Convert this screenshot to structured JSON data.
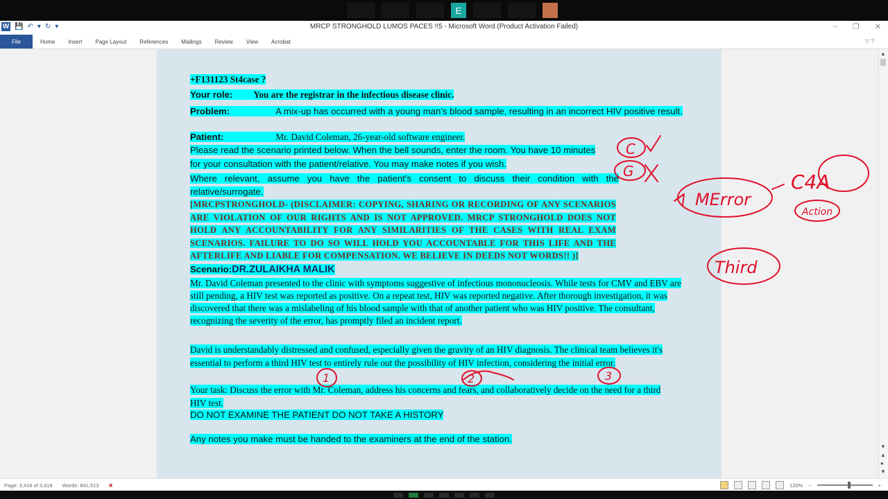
{
  "window": {
    "title": "MRCP STRONGHOLD LUMOS PACES !!5  -  Microsoft Word (Product Activation Failed)"
  },
  "meeting": {
    "self_tile": "E"
  },
  "ribbon": {
    "file": "File",
    "tabs": [
      "Home",
      "Insert",
      "Page Layout",
      "References",
      "Mailings",
      "Review",
      "View",
      "Acrobat"
    ]
  },
  "document": {
    "case_id": "+F131123 St4case ?",
    "role_label": "Your role:",
    "role_text": "You are the registrar in the infectious disease clinic.",
    "problem_label": "Problem:",
    "problem_text": "A mix-up has occurred with a young man's blood sample, resulting in an incorrect HIV positive result.",
    "patient_label": "Patient:",
    "patient_text": "Mr. David Coleman, 26-year-old software engineer.",
    "instructions": "Please read the scenario printed below. When the bell sounds, enter the room. You have 10 minutes for your consultation with the patient/relative. You may make notes if you wish.",
    "consent": "Where relevant, assume you have the patient's consent to discuss their condition with the relative/surrogate.",
    "disclaimer": "[MRCPSTRONGHOLD- (DISCLAIMER: COPYING, SHARING OR RECORDING OF ANY SCENARIOS ARE VIOLATION OF OUR RIGHTS AND IS NOT APPROVED. MRCP STRONGHOLD DOES NOT HOLD ANY ACCOUNTABILITY FOR ANY SIMILARITIES OF THE CASES WITH REAL EXAM SCENARIOS. FAILURE TO DO SO WILL HOLD YOU ACCOUNTABLE FOR THIS LIFE AND THE AFTERLIFE AND LIABLE FOR COMPENSATION. WE BELIEVE IN DEEDS NOT WORDS!! )]",
    "scenario_label": "Scenario:",
    "scenario_author": "DR.ZULAIKHA MALIK",
    "scenario_p1": "Mr. David Coleman presented to the clinic with symptoms suggestive of infectious mononucleosis. While tests for CMV and EBV are still pending, a HIV test was reported as positive. On a repeat test, HIV was reported negative. After thorough investigation, it was discovered that there was a mislabeling of his blood sample with that of another patient who was HIV positive. The consultant, recognizing the severity of the error, has promptly filed an incident report.",
    "scenario_p2": "David is understandably distressed and confused, especially given the gravity of an HIV diagnosis. The clinical team believes it's essential to perform a third HIV test to entirely rule out the possibility of HIV infection, considering the initial error.",
    "task": "Your task: Discuss the error with Mr. Coleman, address his concerns and fears, and collaboratively decide on the need for a third HIV test.",
    "no_exam": "DO NOT EXAMINE THE PATIENT DO NOT TAKE A HISTORY",
    "notes": "Any notes you make must be handed to the examiners at the end of the station."
  },
  "annotations": {
    "left_1": "C",
    "left_2": "G",
    "error_note": "MError",
    "c4a_note": "C4A",
    "action_note": "Action",
    "third_note": "Third",
    "num_1": "1",
    "num_2": "2",
    "num_3": "3",
    "ink_color": "#e0102a"
  },
  "status": {
    "page": "Page: 3,418 of 3,418",
    "words": "Words: 841,513",
    "zoom": "120%"
  }
}
